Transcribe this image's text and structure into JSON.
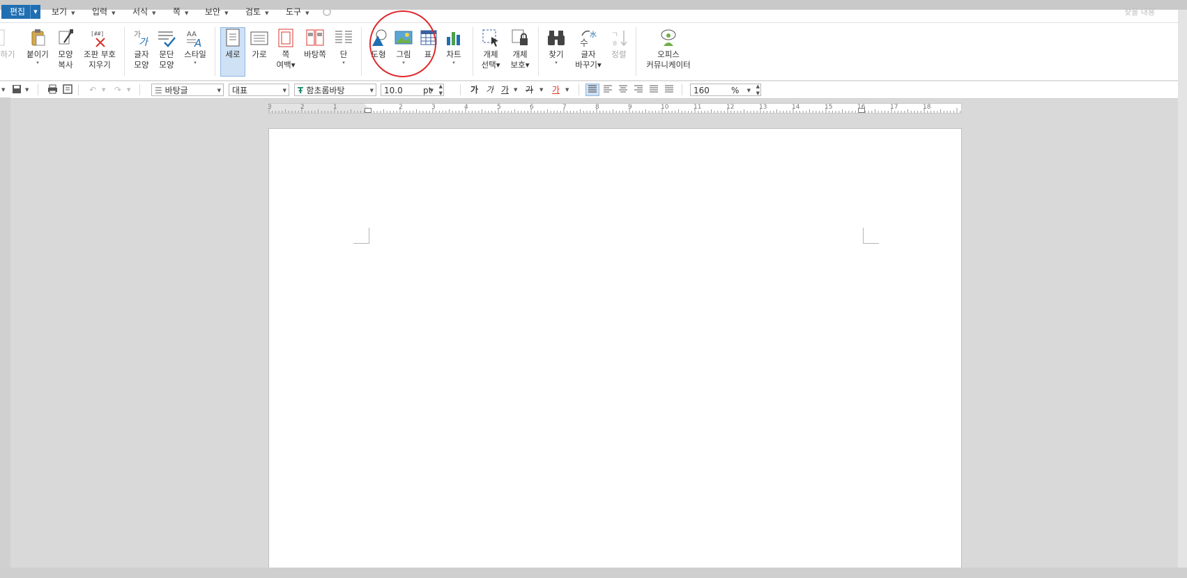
{
  "menubar": {
    "active": "편집",
    "items": [
      "보기",
      "입력",
      "서식",
      "쪽",
      "보안",
      "검토",
      "도구"
    ],
    "search_placeholder": "찾을 내용"
  },
  "ribbon": {
    "left_cut_label": "하기",
    "buttons": [
      {
        "id": "paste",
        "label": "붙이기",
        "sub": "▾",
        "icon": "clipboard-icon"
      },
      {
        "id": "shape-copy",
        "label": "모양",
        "label2": "복사",
        "icon": "format-painter-icon"
      },
      {
        "id": "clear-marks",
        "label": "조판 부호",
        "label2": "지우기",
        "icon": "clear-marks-icon"
      },
      {
        "id": "char-shape",
        "label": "글자",
        "label2": "모양",
        "icon": "char-shape-icon"
      },
      {
        "id": "para-shape",
        "label": "문단",
        "label2": "모양",
        "icon": "para-shape-icon"
      },
      {
        "id": "style",
        "label": "스타일",
        "sub": "▾",
        "icon": "style-icon"
      },
      {
        "id": "portrait",
        "label": "세로",
        "icon": "portrait-page-icon"
      },
      {
        "id": "landscape",
        "label": "가로",
        "icon": "landscape-page-icon"
      },
      {
        "id": "margin",
        "label": "쪽",
        "label2": "여백▾",
        "icon": "page-margin-icon"
      },
      {
        "id": "master-page",
        "label": "바탕쪽",
        "icon": "master-page-icon"
      },
      {
        "id": "columns",
        "label": "단",
        "sub": "▾",
        "icon": "columns-icon"
      },
      {
        "id": "shape",
        "label": "도형",
        "icon": "shape-icon"
      },
      {
        "id": "picture",
        "label": "그림",
        "sub": "▾",
        "icon": "picture-icon"
      },
      {
        "id": "table",
        "label": "표",
        "icon": "table-icon"
      },
      {
        "id": "chart",
        "label": "차트",
        "sub": "▾",
        "icon": "chart-icon"
      },
      {
        "id": "obj-select",
        "label": "개체",
        "label2": "선택▾",
        "icon": "object-select-icon"
      },
      {
        "id": "obj-protect",
        "label": "개체",
        "label2": "보호▾",
        "icon": "object-protect-icon"
      },
      {
        "id": "find",
        "label": "찾기",
        "sub": "▾",
        "icon": "binoculars-icon"
      },
      {
        "id": "replace",
        "label": "글자",
        "label2": "바꾸기▾",
        "icon": "char-replace-icon"
      },
      {
        "id": "sort",
        "label": "정렬",
        "icon": "sort-icon"
      },
      {
        "id": "messenger",
        "label": "오피스",
        "label2": "커뮤니케이터",
        "icon": "messenger-icon"
      }
    ]
  },
  "formatbar": {
    "style": "바탕글",
    "language": "대표",
    "font": "함초롬바탕",
    "font_size": "10.0",
    "font_unit": "pt",
    "bold": "가",
    "italic": "가",
    "underline": "가",
    "strike": "가",
    "color": "가",
    "zoom": "160",
    "zoom_unit": "%"
  },
  "ruler": {
    "labels": [
      "3",
      "2",
      "1",
      "1",
      "2",
      "3",
      "4",
      "5",
      "6",
      "7",
      "8",
      "9",
      "10",
      "11",
      "12",
      "13",
      "14",
      "15",
      "16",
      "17",
      "18"
    ]
  },
  "colors": {
    "accent": "#1f6fb2",
    "highlight": "#e0282b"
  }
}
